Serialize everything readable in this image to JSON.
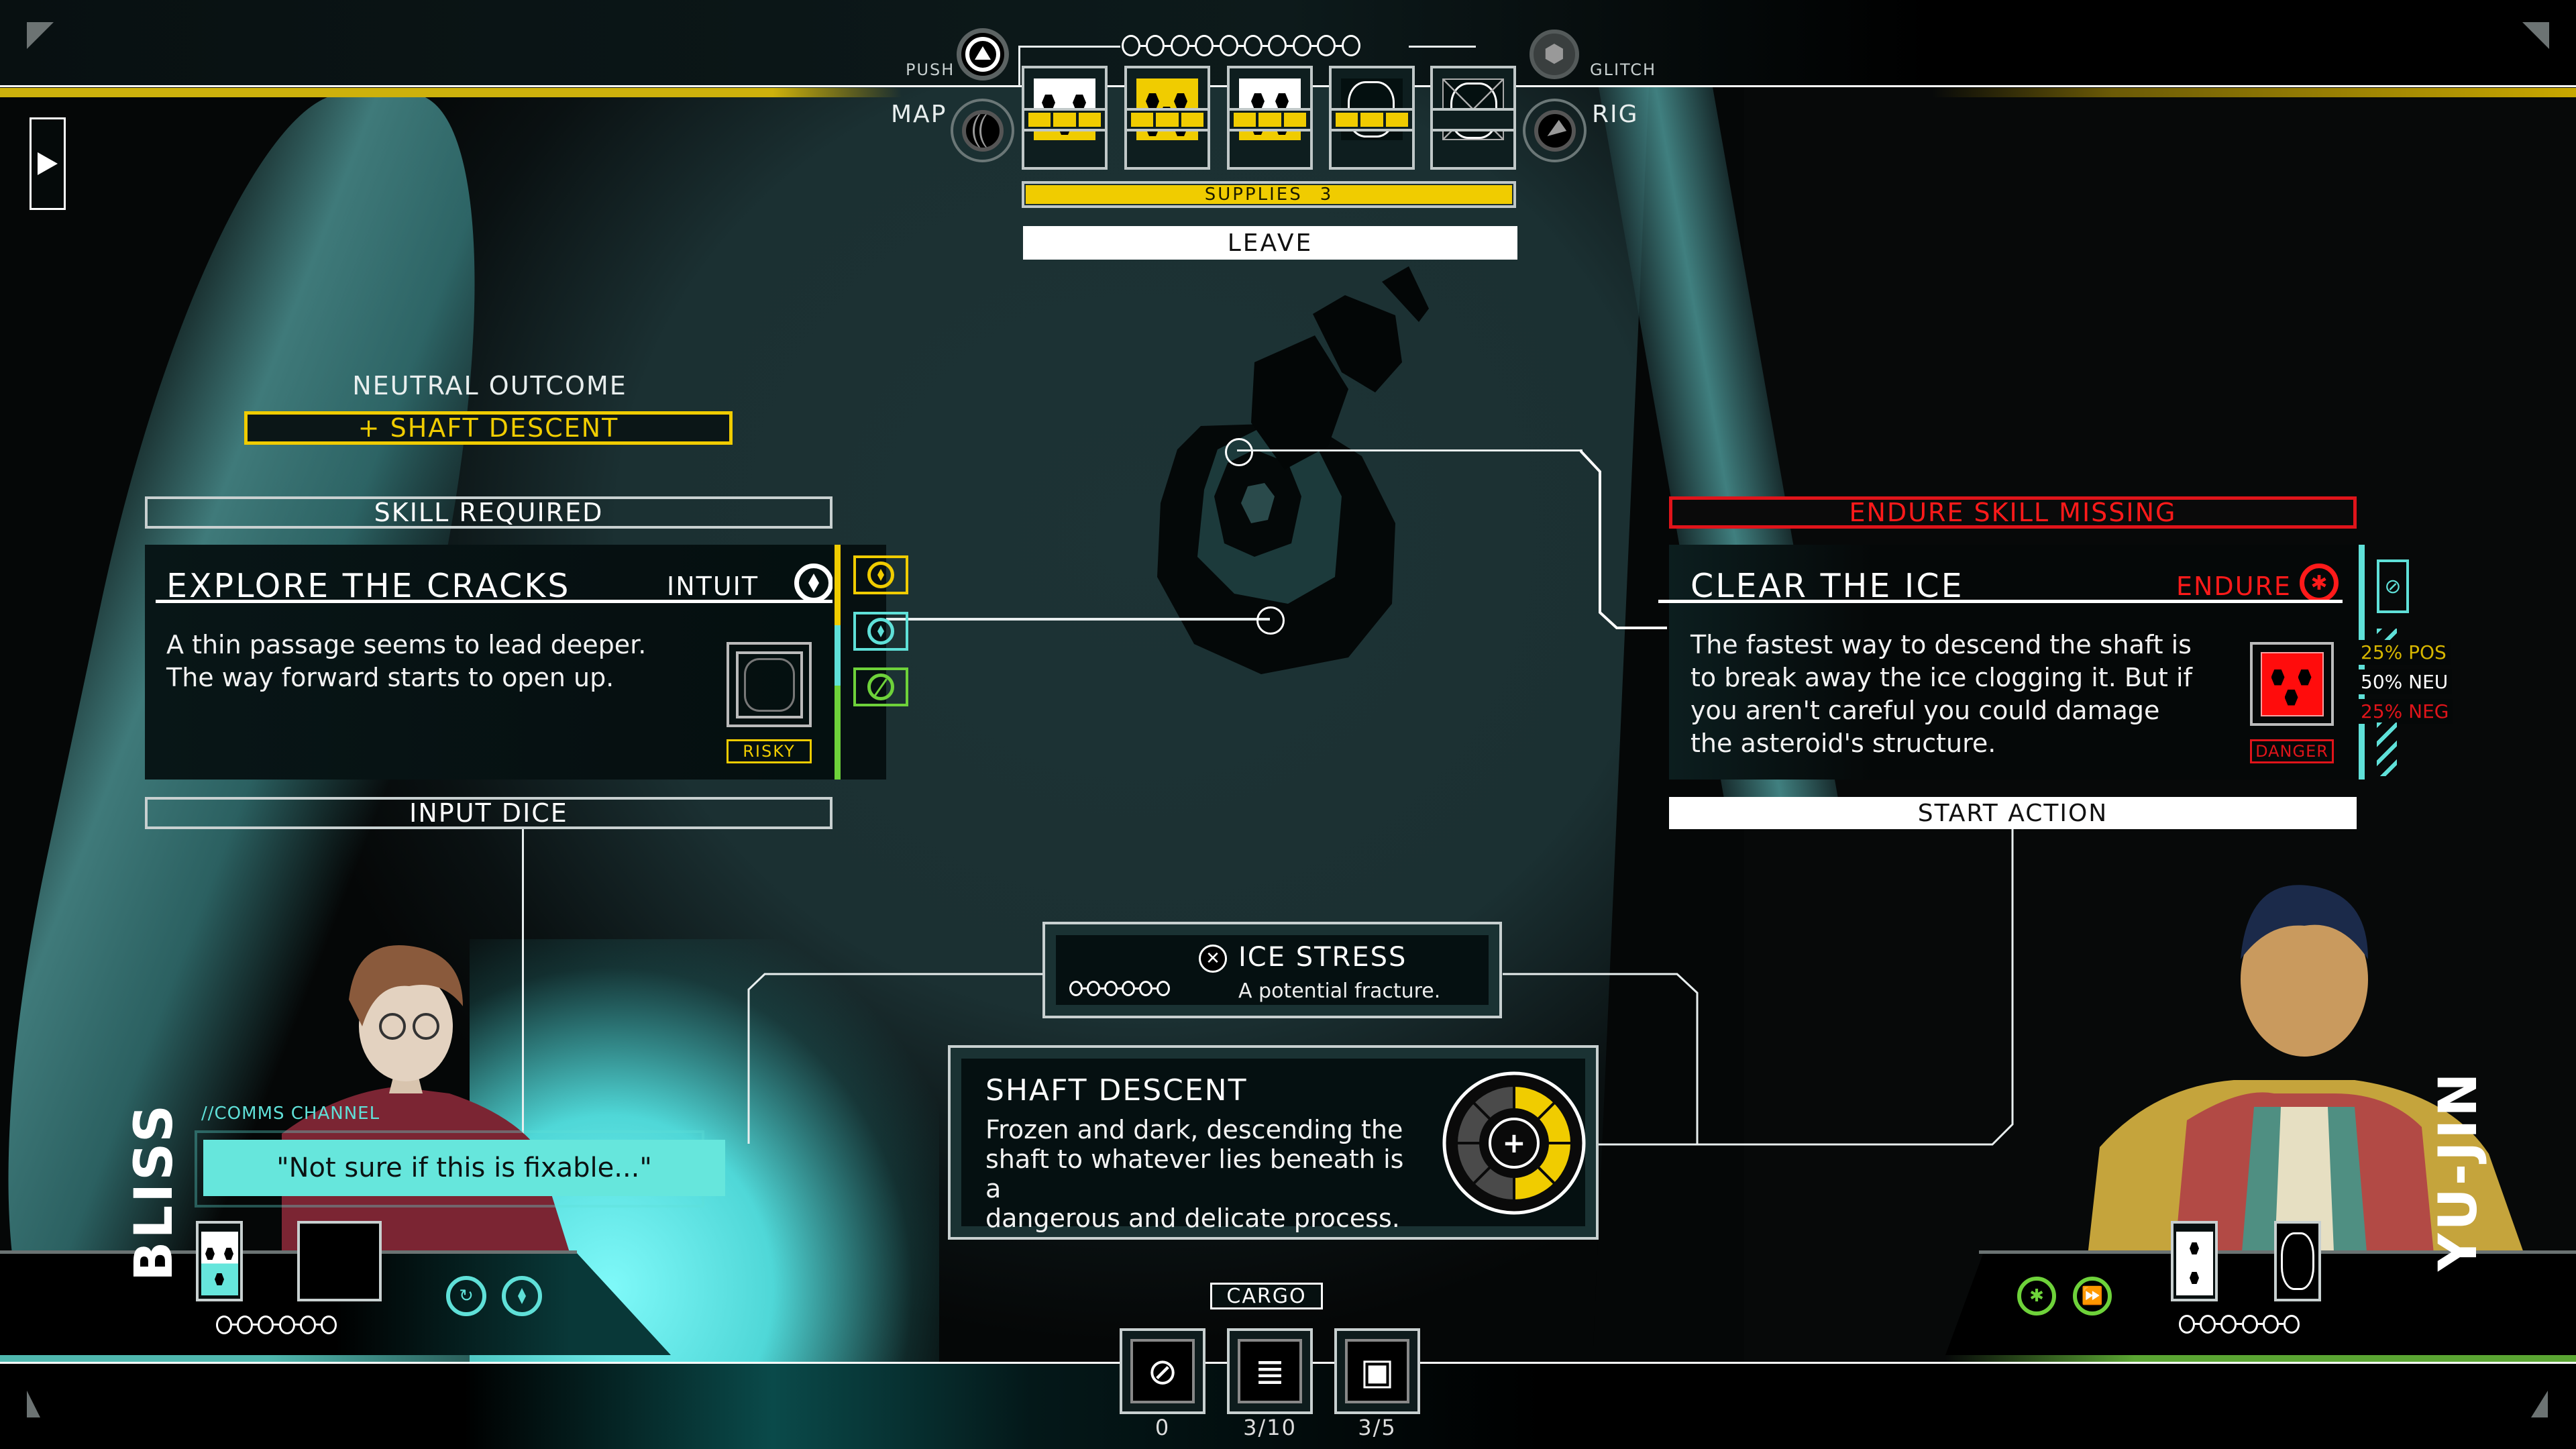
{
  "top_hud": {
    "push_label": "PUSH",
    "map_label": "MAP",
    "glitch_label": "GLITCH",
    "rig_label": "RIG",
    "stress_track_pips": 10,
    "supplies_label": "SUPPLIES",
    "supplies_value": "3",
    "leave_label": "LEAVE",
    "dice": [
      {
        "face": 3,
        "style": "white-yellow",
        "charges": 3
      },
      {
        "face": 5,
        "style": "yellow",
        "charges": 3
      },
      {
        "face": 4,
        "style": "white-yellow",
        "charges": 3
      },
      {
        "face": null,
        "style": "empty",
        "charges": 3
      },
      {
        "face": null,
        "style": "crossed",
        "charges": 0
      }
    ]
  },
  "left_action": {
    "outcome_heading": "NEUTRAL OUTCOME",
    "outcome_value": "+ SHAFT DESCENT",
    "requirement_label": "SKILL REQUIRED",
    "title": "EXPLORE THE CRACKS",
    "skill_label": "INTUIT",
    "description": "A thin passage seems to lead deeper. The way forward starts to open up.",
    "description_lines": [
      "A thin passage seems to lead deeper.",
      "The way forward starts to open up."
    ],
    "risk_badge": "RISKY",
    "input_label": "INPUT DICE",
    "side_skills": [
      "intuit-yellow",
      "intuit-cyan",
      "skill-disabled-green"
    ],
    "colors": {
      "yellow": "#f0cc00",
      "cyan": "#5fe0d8",
      "green": "#6ed23a"
    }
  },
  "right_action": {
    "requirement_label": "ENDURE SKILL MISSING",
    "title": "CLEAR THE ICE",
    "skill_label": "ENDURE",
    "description_lines": [
      "The fastest way to descend the shaft is",
      "to break away the ice clogging it. But if",
      "you aren't careful you could damage",
      "the asteroid's structure."
    ],
    "danger_badge": "DANGER",
    "odds": [
      {
        "label": "25% POS",
        "color": "#d6b600"
      },
      {
        "label": "50% NEU",
        "color": "#ffffff"
      },
      {
        "label": "25% NEG",
        "color": "#e0141a"
      }
    ],
    "start_label": "START ACTION",
    "colors": {
      "red": "#ff1a1a",
      "cyan": "#5fe0d8"
    }
  },
  "threats": {
    "ice_stress": {
      "title": "ICE STRESS",
      "subtitle": "A potential fracture.",
      "track_pips": 6
    },
    "shaft_descent": {
      "title": "SHAFT DESCENT",
      "description_lines": [
        "Frozen and dark, descending the",
        "shaft to whatever lies beneath is a",
        "dangerous and delicate process."
      ],
      "clock_segments": 8,
      "clock_filled": 4
    }
  },
  "crew_left": {
    "name": "BLISS",
    "comms_label": "//COMMS CHANNEL",
    "quote": "\"Not sure if this is fixable...\"",
    "stress_pips": 6,
    "accent": "#5fe0d8"
  },
  "crew_right": {
    "name": "YU-JIN",
    "stress_pips": 6,
    "accent": "#6ed23a"
  },
  "cargo": {
    "label": "CARGO",
    "items": [
      {
        "icon": "no-card-icon",
        "value": "0"
      },
      {
        "icon": "data-storage-icon",
        "value": "3/10"
      },
      {
        "icon": "crates-icon",
        "value": "3/5"
      }
    ]
  }
}
